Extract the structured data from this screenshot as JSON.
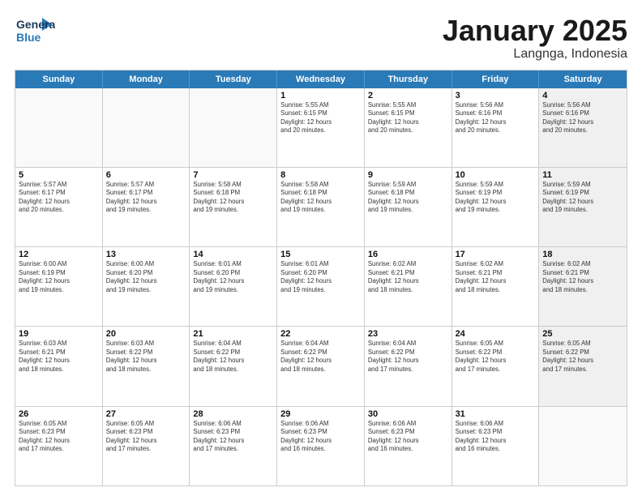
{
  "logo": {
    "line1": "General",
    "line2": "Blue"
  },
  "calendar": {
    "title": "January 2025",
    "subtitle": "Langnga, Indonesia",
    "headers": [
      "Sunday",
      "Monday",
      "Tuesday",
      "Wednesday",
      "Thursday",
      "Friday",
      "Saturday"
    ],
    "weeks": [
      [
        {
          "day": "",
          "info": "",
          "empty": true
        },
        {
          "day": "",
          "info": "",
          "empty": true
        },
        {
          "day": "",
          "info": "",
          "empty": true
        },
        {
          "day": "1",
          "info": "Sunrise: 5:55 AM\nSunset: 6:15 PM\nDaylight: 12 hours\nand 20 minutes."
        },
        {
          "day": "2",
          "info": "Sunrise: 5:55 AM\nSunset: 6:15 PM\nDaylight: 12 hours\nand 20 minutes."
        },
        {
          "day": "3",
          "info": "Sunrise: 5:56 AM\nSunset: 6:16 PM\nDaylight: 12 hours\nand 20 minutes."
        },
        {
          "day": "4",
          "info": "Sunrise: 5:56 AM\nSunset: 6:16 PM\nDaylight: 12 hours\nand 20 minutes.",
          "shaded": true
        }
      ],
      [
        {
          "day": "5",
          "info": "Sunrise: 5:57 AM\nSunset: 6:17 PM\nDaylight: 12 hours\nand 20 minutes."
        },
        {
          "day": "6",
          "info": "Sunrise: 5:57 AM\nSunset: 6:17 PM\nDaylight: 12 hours\nand 19 minutes."
        },
        {
          "day": "7",
          "info": "Sunrise: 5:58 AM\nSunset: 6:18 PM\nDaylight: 12 hours\nand 19 minutes."
        },
        {
          "day": "8",
          "info": "Sunrise: 5:58 AM\nSunset: 6:18 PM\nDaylight: 12 hours\nand 19 minutes."
        },
        {
          "day": "9",
          "info": "Sunrise: 5:59 AM\nSunset: 6:18 PM\nDaylight: 12 hours\nand 19 minutes."
        },
        {
          "day": "10",
          "info": "Sunrise: 5:59 AM\nSunset: 6:19 PM\nDaylight: 12 hours\nand 19 minutes."
        },
        {
          "day": "11",
          "info": "Sunrise: 5:59 AM\nSunset: 6:19 PM\nDaylight: 12 hours\nand 19 minutes.",
          "shaded": true
        }
      ],
      [
        {
          "day": "12",
          "info": "Sunrise: 6:00 AM\nSunset: 6:19 PM\nDaylight: 12 hours\nand 19 minutes."
        },
        {
          "day": "13",
          "info": "Sunrise: 6:00 AM\nSunset: 6:20 PM\nDaylight: 12 hours\nand 19 minutes."
        },
        {
          "day": "14",
          "info": "Sunrise: 6:01 AM\nSunset: 6:20 PM\nDaylight: 12 hours\nand 19 minutes."
        },
        {
          "day": "15",
          "info": "Sunrise: 6:01 AM\nSunset: 6:20 PM\nDaylight: 12 hours\nand 19 minutes."
        },
        {
          "day": "16",
          "info": "Sunrise: 6:02 AM\nSunset: 6:21 PM\nDaylight: 12 hours\nand 18 minutes."
        },
        {
          "day": "17",
          "info": "Sunrise: 6:02 AM\nSunset: 6:21 PM\nDaylight: 12 hours\nand 18 minutes."
        },
        {
          "day": "18",
          "info": "Sunrise: 6:02 AM\nSunset: 6:21 PM\nDaylight: 12 hours\nand 18 minutes.",
          "shaded": true
        }
      ],
      [
        {
          "day": "19",
          "info": "Sunrise: 6:03 AM\nSunset: 6:21 PM\nDaylight: 12 hours\nand 18 minutes."
        },
        {
          "day": "20",
          "info": "Sunrise: 6:03 AM\nSunset: 6:22 PM\nDaylight: 12 hours\nand 18 minutes."
        },
        {
          "day": "21",
          "info": "Sunrise: 6:04 AM\nSunset: 6:22 PM\nDaylight: 12 hours\nand 18 minutes."
        },
        {
          "day": "22",
          "info": "Sunrise: 6:04 AM\nSunset: 6:22 PM\nDaylight: 12 hours\nand 18 minutes."
        },
        {
          "day": "23",
          "info": "Sunrise: 6:04 AM\nSunset: 6:22 PM\nDaylight: 12 hours\nand 17 minutes."
        },
        {
          "day": "24",
          "info": "Sunrise: 6:05 AM\nSunset: 6:22 PM\nDaylight: 12 hours\nand 17 minutes."
        },
        {
          "day": "25",
          "info": "Sunrise: 6:05 AM\nSunset: 6:22 PM\nDaylight: 12 hours\nand 17 minutes.",
          "shaded": true
        }
      ],
      [
        {
          "day": "26",
          "info": "Sunrise: 6:05 AM\nSunset: 6:23 PM\nDaylight: 12 hours\nand 17 minutes."
        },
        {
          "day": "27",
          "info": "Sunrise: 6:05 AM\nSunset: 6:23 PM\nDaylight: 12 hours\nand 17 minutes."
        },
        {
          "day": "28",
          "info": "Sunrise: 6:06 AM\nSunset: 6:23 PM\nDaylight: 12 hours\nand 17 minutes."
        },
        {
          "day": "29",
          "info": "Sunrise: 6:06 AM\nSunset: 6:23 PM\nDaylight: 12 hours\nand 16 minutes."
        },
        {
          "day": "30",
          "info": "Sunrise: 6:06 AM\nSunset: 6:23 PM\nDaylight: 12 hours\nand 16 minutes."
        },
        {
          "day": "31",
          "info": "Sunrise: 6:06 AM\nSunset: 6:23 PM\nDaylight: 12 hours\nand 16 minutes."
        },
        {
          "day": "",
          "info": "",
          "empty": true,
          "shaded": true
        }
      ]
    ]
  }
}
